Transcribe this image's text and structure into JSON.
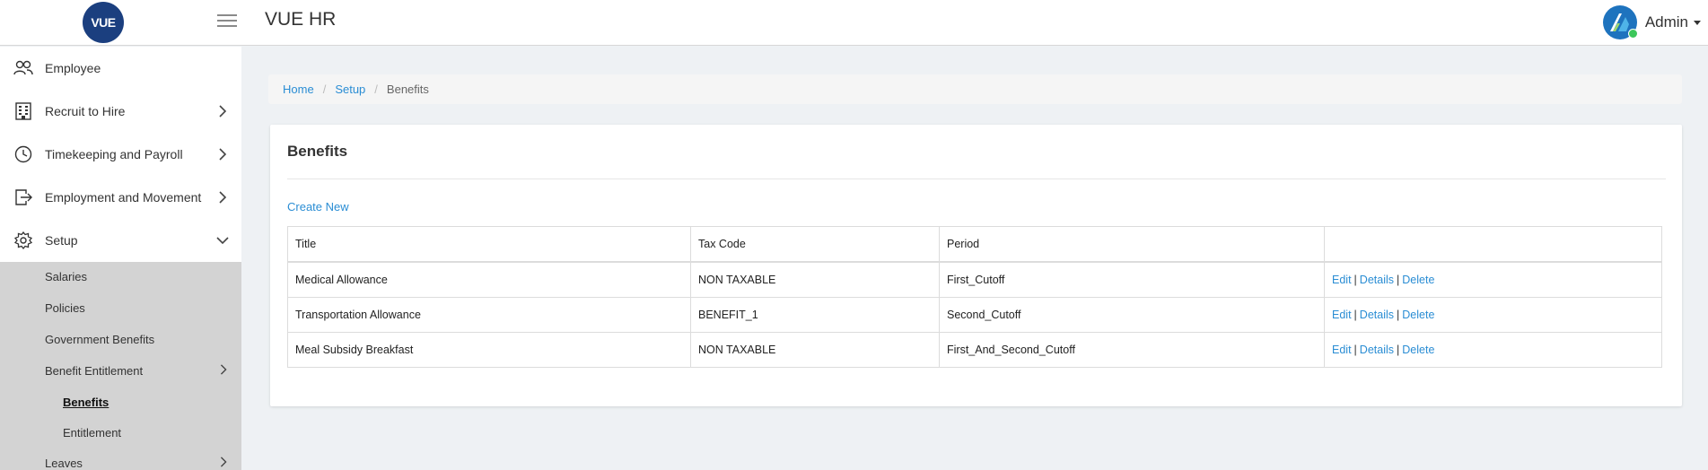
{
  "header": {
    "logo_text": "VUE",
    "app_title": "VUE HR",
    "user_name": "Admin",
    "brand_color": "#1b3f7f",
    "status_color": "#3cc75a"
  },
  "sidebar": {
    "items": [
      {
        "label": "Employee",
        "icon": "people-icon"
      },
      {
        "label": "Recruit to Hire",
        "icon": "building-icon"
      },
      {
        "label": "Timekeeping and Payroll",
        "icon": "clock-icon"
      },
      {
        "label": "Employment and Movement",
        "icon": "exit-icon"
      },
      {
        "label": "Setup",
        "icon": "gear-icon"
      }
    ],
    "setup_sub": {
      "salaries": "Salaries",
      "policies": "Policies",
      "government_benefits": "Government Benefits",
      "benefit_entitlement": "Benefit Entitlement",
      "benefits": "Benefits",
      "entitlement": "Entitlement",
      "leaves": "Leaves"
    }
  },
  "breadcrumb": {
    "home": "Home",
    "setup": "Setup",
    "current": "Benefits"
  },
  "page": {
    "title": "Benefits",
    "create_new": "Create New"
  },
  "table": {
    "headers": [
      "Title",
      "Tax Code",
      "Period",
      ""
    ],
    "rows": [
      {
        "title": "Medical Allowance",
        "tax_code": "NON TAXABLE",
        "period": "First_Cutoff"
      },
      {
        "title": "Transportation Allowance",
        "tax_code": "BENEFIT_1",
        "period": "Second_Cutoff"
      },
      {
        "title": "Meal Subsidy Breakfast",
        "tax_code": "NON TAXABLE",
        "period": "First_And_Second_Cutoff"
      }
    ],
    "actions": {
      "edit": "Edit",
      "details": "Details",
      "delete": "Delete",
      "separator": "|"
    }
  },
  "colors": {
    "link": "#2a8dd4",
    "submenu_bg": "#d3d3d3",
    "page_bg": "#eef1f4"
  }
}
